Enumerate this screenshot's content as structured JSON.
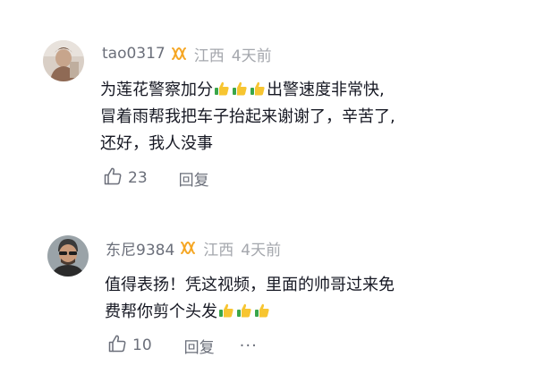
{
  "comments": [
    {
      "username": "tao0317",
      "badge_icon": "double-helix-badge-icon",
      "location": "江西",
      "time": "4天前",
      "content": {
        "line1_text": "为莲花警察加分",
        "line1_emojis": [
          "thumbs-up-emoji",
          "thumbs-up-emoji",
          "thumbs-up-emoji"
        ],
        "line1_tail": "出警速度非常快,",
        "line2": "冒着雨帮我把车子抬起来谢谢了，辛苦了,",
        "line3": "还好，我人没事"
      },
      "likes": "23",
      "reply_label": "回复"
    },
    {
      "username": "东尼9384",
      "badge_icon": "double-helix-badge-icon",
      "location": "江西",
      "time": "4天前",
      "content": {
        "line1": "值得表扬！凭这视频，里面的帅哥过来免",
        "line2_text": "费帮你剪个头发",
        "line2_emojis": [
          "thumbs-up-emoji",
          "thumbs-up-emoji",
          "thumbs-up-emoji"
        ]
      },
      "likes": "10",
      "reply_label": "回复",
      "more_label": "···"
    }
  ],
  "colors": {
    "primary_text": "#161823",
    "secondary_text": "#6b6f7a",
    "tertiary_text": "#a4a7ad",
    "badge": "#f5a623",
    "background": "#ffffff"
  }
}
